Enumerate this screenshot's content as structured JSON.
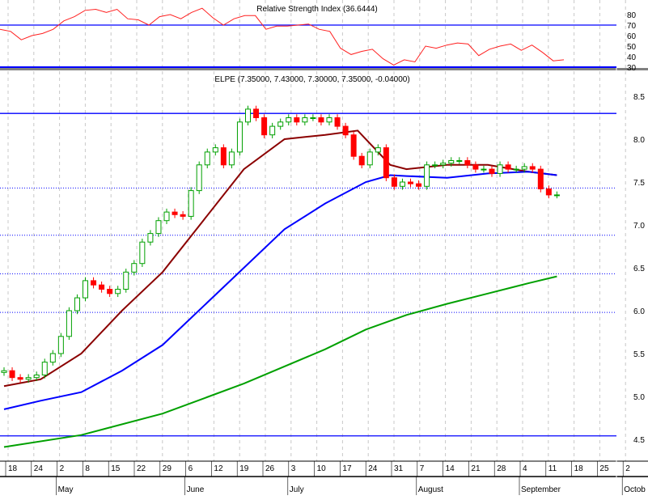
{
  "chart_data": [
    {
      "type": "line",
      "title": "Relative Strength Index (36.6444)",
      "ylim": [
        30,
        80
      ],
      "yticks": [
        "80",
        "70",
        "60",
        "50",
        "40",
        "30"
      ],
      "reference_lines": [
        70,
        30
      ],
      "series": [
        {
          "name": "RSI",
          "color": "#ff2020",
          "values": [
            66,
            64,
            56,
            60,
            62,
            66,
            74,
            78,
            84,
            85,
            82,
            85,
            76,
            75,
            70,
            78,
            80,
            76,
            82,
            86,
            77,
            70,
            76,
            79,
            79,
            66,
            69,
            69,
            70,
            71,
            66,
            64,
            48,
            42,
            45,
            47,
            38,
            32,
            37,
            35,
            50,
            48,
            51,
            53,
            52,
            41,
            47,
            50,
            52,
            46,
            51,
            44,
            36,
            37
          ]
        }
      ]
    },
    {
      "type": "candlestick",
      "title": "ELPE (7.35000, 7.43000, 7.30000, 7.35000, -0.04000)",
      "ylim": [
        4.4,
        8.55
      ],
      "yticks": [
        "8.5",
        "8.0",
        "7.5",
        "7.0",
        "6.5",
        "6.0",
        "5.5",
        "5.0",
        "4.5"
      ],
      "first_open": 5.28,
      "closes": [
        5.3,
        5.22,
        5.2,
        5.22,
        5.25,
        5.4,
        5.5,
        5.7,
        6.0,
        6.15,
        6.35,
        6.3,
        6.25,
        6.2,
        6.25,
        6.45,
        6.55,
        6.8,
        6.9,
        7.05,
        7.15,
        7.12,
        7.1,
        7.4,
        7.7,
        7.85,
        7.9,
        7.7,
        7.85,
        8.2,
        8.35,
        8.25,
        8.05,
        8.15,
        8.2,
        8.25,
        8.2,
        8.25,
        8.25,
        8.2,
        8.25,
        8.15,
        8.05,
        7.8,
        7.7,
        7.85,
        7.9,
        7.55,
        7.45,
        7.5,
        7.48,
        7.45,
        7.7,
        7.7,
        7.72,
        7.75,
        7.75,
        7.7,
        7.65,
        7.65,
        7.6,
        7.7,
        7.65,
        7.65,
        7.68,
        7.65,
        7.42,
        7.35,
        7.35
      ],
      "moving_averages": [
        {
          "name": "short MA",
          "color": "#8b0000",
          "points": [
            [
              0,
              5.12
            ],
            [
              4.5,
              5.2
            ],
            [
              9.5,
              5.5
            ],
            [
              14.5,
              6.0
            ],
            [
              19.5,
              6.45
            ],
            [
              24.5,
              7.05
            ],
            [
              29.5,
              7.65
            ],
            [
              34.5,
              8.0
            ],
            [
              39.5,
              8.05
            ],
            [
              43.5,
              8.1
            ],
            [
              47.5,
              7.7
            ],
            [
              49.5,
              7.65
            ],
            [
              54.5,
              7.7
            ],
            [
              59.5,
              7.7
            ],
            [
              64.5,
              7.62
            ],
            [
              68,
              7.58
            ]
          ]
        },
        {
          "name": "medium MA",
          "color": "#0000ff",
          "points": [
            [
              0,
              4.85
            ],
            [
              4.5,
              4.95
            ],
            [
              9.5,
              5.05
            ],
            [
              14.5,
              5.3
            ],
            [
              19.5,
              5.6
            ],
            [
              24.5,
              6.05
            ],
            [
              29.5,
              6.5
            ],
            [
              34.5,
              6.95
            ],
            [
              39.5,
              7.25
            ],
            [
              44.5,
              7.5
            ],
            [
              47.5,
              7.58
            ],
            [
              49.5,
              7.57
            ],
            [
              54.5,
              7.55
            ],
            [
              59.5,
              7.6
            ],
            [
              64.5,
              7.62
            ],
            [
              68,
              7.58
            ]
          ]
        },
        {
          "name": "long MA",
          "color": "#00a000",
          "points": [
            [
              0,
              4.41
            ],
            [
              9.5,
              4.55
            ],
            [
              19.5,
              4.8
            ],
            [
              29.5,
              5.15
            ],
            [
              39.5,
              5.55
            ],
            [
              44.5,
              5.78
            ],
            [
              49.5,
              5.95
            ],
            [
              54.5,
              6.08
            ],
            [
              59.5,
              6.2
            ],
            [
              64.5,
              6.32
            ],
            [
              68,
              6.4
            ]
          ]
        }
      ],
      "solid_levels": [
        8.3,
        4.54
      ],
      "dotted_levels": [
        7.43,
        6.88,
        6.43,
        5.98
      ]
    }
  ],
  "xaxis": {
    "days": [
      "18",
      "24",
      "2",
      "8",
      "15",
      "22",
      "29",
      "6",
      "12",
      "19",
      "26",
      "3",
      "10",
      "17",
      "24",
      "31",
      "7",
      "14",
      "21",
      "28",
      "4",
      "11",
      "18",
      "25",
      "2"
    ],
    "months": [
      {
        "label": "May",
        "after_day": 2
      },
      {
        "label": "June",
        "after_day": 7
      },
      {
        "label": "July",
        "after_day": 11
      },
      {
        "label": "August",
        "after_day": 16
      },
      {
        "label": "September",
        "after_day": 20
      },
      {
        "label": "Octob",
        "after_day": 24
      }
    ]
  },
  "colors": {
    "up": "#00a000",
    "down": "#ff0000",
    "ref": "#0000ff",
    "grid": "#c8c8c8"
  }
}
